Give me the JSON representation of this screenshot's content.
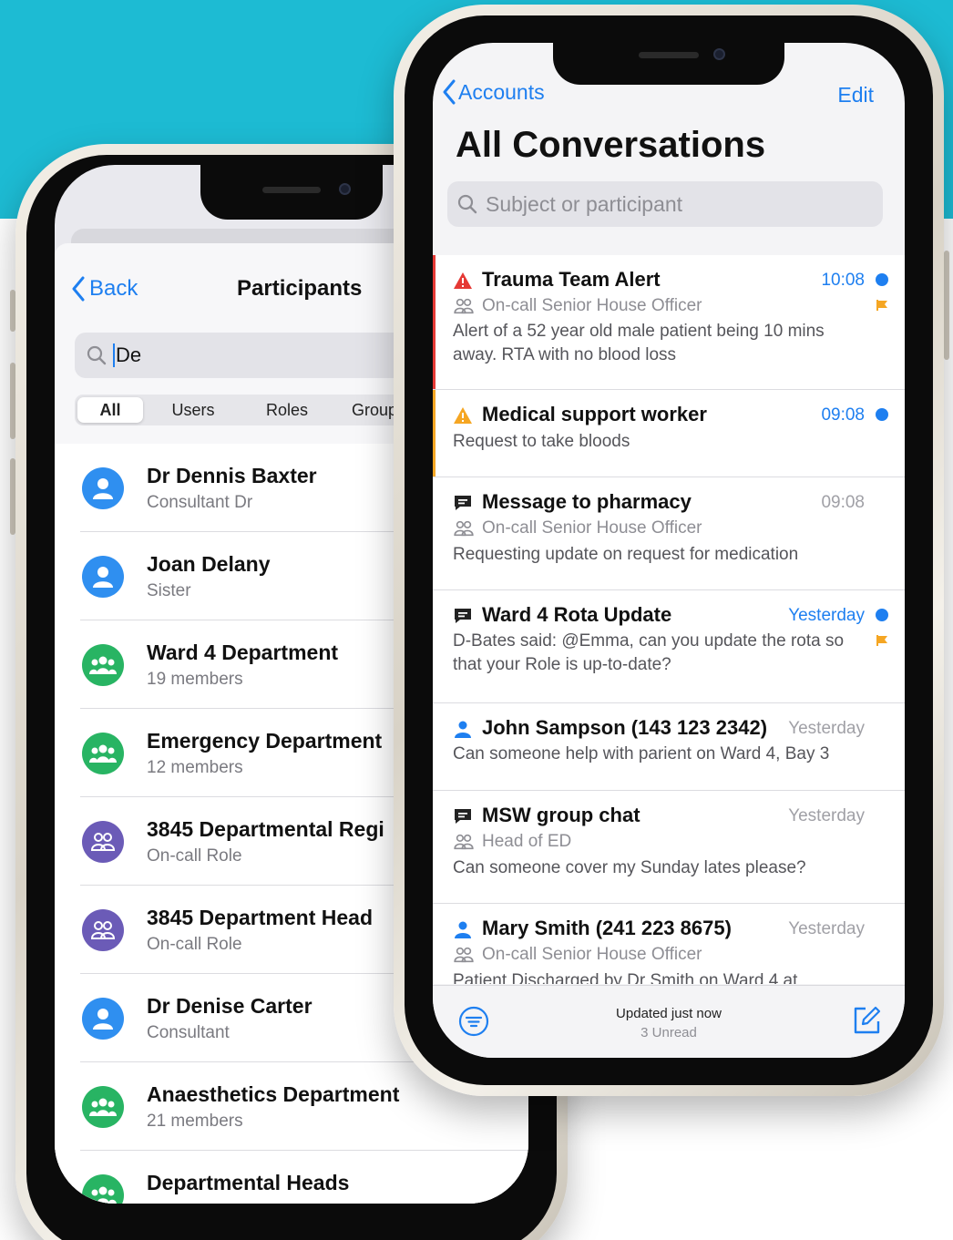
{
  "colors": {
    "teal": "#1dbbd3",
    "ios_blue": "#1e7ff0",
    "red_alert": "#e53935",
    "orange_alert": "#f5a623",
    "flag": "#f5a623",
    "user_avatar": "#2f8ff0",
    "group_avatar": "#28b463",
    "role_avatar": "#6b5bb7"
  },
  "participants": {
    "back_label": "Back",
    "title": "Participants",
    "search_value": "De",
    "tabs": [
      "All",
      "Users",
      "Roles",
      "Group"
    ],
    "active_tab": "All",
    "rows": [
      {
        "name": "Dr Dennis Baxter",
        "sub": "Consultant Dr",
        "kind": "user"
      },
      {
        "name": "Joan Delany",
        "sub": "Sister",
        "kind": "user"
      },
      {
        "name": "Ward 4 Department",
        "sub": "19 members",
        "kind": "group"
      },
      {
        "name": "Emergency Department",
        "sub": "12 members",
        "kind": "group"
      },
      {
        "name": "3845 Departmental Regi",
        "sub": "On-call Role",
        "kind": "role"
      },
      {
        "name": "3845 Department Head",
        "sub": "On-call Role",
        "kind": "role"
      },
      {
        "name": "Dr Denise Carter",
        "sub": "Consultant",
        "kind": "user"
      },
      {
        "name": "Anaesthetics Department",
        "sub": "21 members",
        "kind": "group"
      },
      {
        "name": "Departmental Heads",
        "sub": "",
        "kind": "group"
      }
    ]
  },
  "conversations": {
    "back_label": "Accounts",
    "edit_label": "Edit",
    "title": "All Conversations",
    "search_placeholder": "Subject or participant",
    "items": [
      {
        "icon": "warning-red-icon",
        "title": "Trauma Team Alert",
        "time": "10:08",
        "unread": true,
        "flagged": true,
        "accent": "#e53935",
        "role": "On-call Senior House Officer",
        "preview": "Alert of a 52 year old male patient being 10 mins away. RTA with no blood loss"
      },
      {
        "icon": "warning-orange-icon",
        "title": "Medical support worker",
        "time": "09:08",
        "unread": true,
        "flagged": false,
        "accent": "#f5a623",
        "role": "",
        "preview": "Request to take bloods"
      },
      {
        "icon": "message-icon",
        "title": "Message to pharmacy",
        "time": "09:08",
        "unread": false,
        "flagged": false,
        "accent": "",
        "role": "On-call Senior House Officer",
        "preview": "Requesting update on request for medication"
      },
      {
        "icon": "message-icon",
        "title": "Ward 4 Rota Update",
        "time": "Yesterday",
        "unread": true,
        "flagged": true,
        "accent": "",
        "role": "",
        "preview": "D-Bates said: @Emma, can you update the rota so that your Role is up-to-date?"
      },
      {
        "icon": "person-icon",
        "title": "John Sampson (143 123 2342)",
        "time": "Yesterday",
        "unread": false,
        "flagged": false,
        "accent": "",
        "role": "",
        "preview": "Can someone help with parient on Ward 4, Bay 3"
      },
      {
        "icon": "message-icon",
        "title": "MSW group chat",
        "time": "Yesterday",
        "unread": false,
        "flagged": false,
        "accent": "",
        "role": "Head of ED",
        "preview": "Can someone cover my Sunday lates please?"
      },
      {
        "icon": "person-icon",
        "title": "Mary Smith (241 223 8675)",
        "time": "Yesterday",
        "unread": false,
        "flagged": false,
        "accent": "",
        "role": "On-call Senior House Officer",
        "preview": "Patient Discharged by Dr Smith on Ward 4 at"
      }
    ],
    "toolbar": {
      "status": "Updated just now",
      "unread_count": "3 Unread"
    }
  }
}
